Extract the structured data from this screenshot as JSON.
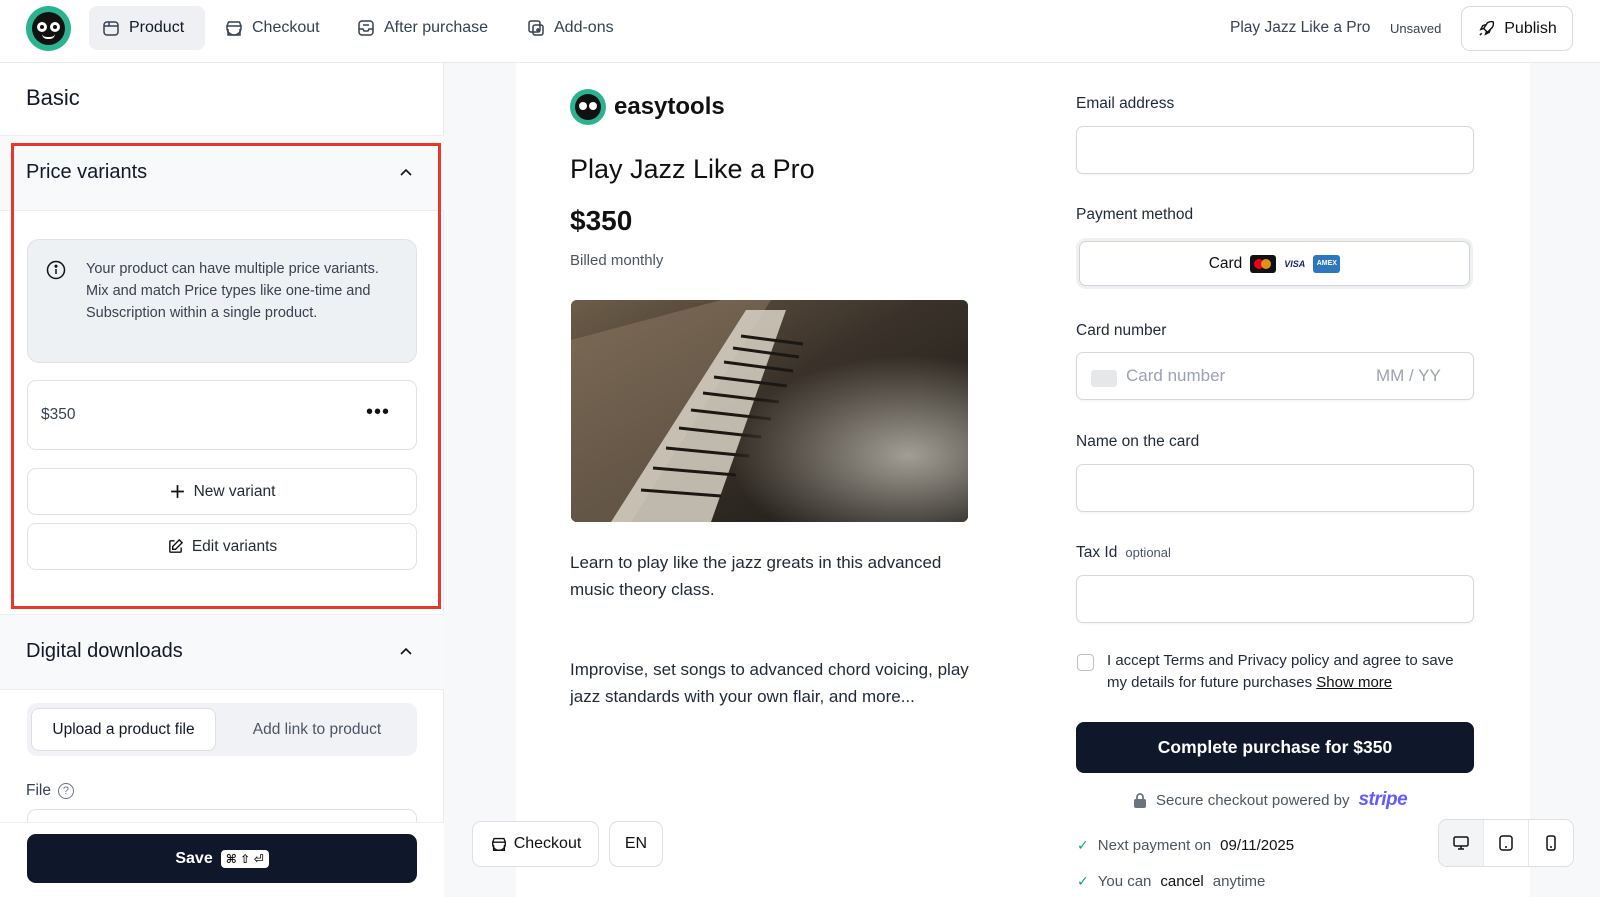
{
  "topbar": {
    "nav": [
      "Product",
      "Checkout",
      "After purchase",
      "Add-ons"
    ],
    "doc_title": "Play Jazz Like a Pro",
    "status": "Unsaved",
    "publish_label": "Publish"
  },
  "sidebar": {
    "basic_heading": "Basic",
    "price_variants": {
      "heading": "Price variants",
      "info": "Your product can have multiple price variants. Mix and match Price types like one-time and Subscription within a single product.",
      "variants": [
        "$350"
      ],
      "new_variant_label": "New variant",
      "edit_variants_label": "Edit variants"
    },
    "digital_downloads": {
      "heading": "Digital downloads",
      "tabs": [
        "Upload a product file",
        "Add link to product"
      ],
      "file_label": "File",
      "help_glyph": "?"
    },
    "save_label": "Save",
    "save_shortcut": "⌘ ⇧ ⏎"
  },
  "preview": {
    "brand": "easytools",
    "title": "Play Jazz Like a Pro",
    "price": "$350",
    "billing": "Billed monthly",
    "description_1": "Learn to play like the jazz greats in this advanced music theory class.",
    "description_2": "Improvise, set songs to advanced chord voicing, play jazz standards with your own flair, and more...",
    "checkout_pill": "Checkout",
    "lang_pill": "EN"
  },
  "checkout": {
    "email_label": "Email address",
    "payment_label": "Payment method",
    "payment_card": "Card",
    "card_brands": [
      "mastercard-icon",
      "visa-icon",
      "amex-icon"
    ],
    "visa_text": "VISA",
    "amex_text": "AMEX",
    "card_number_label": "Card number",
    "card_number_placeholder": "Card number",
    "expiry_placeholder": "MM / YY",
    "name_label": "Name on the card",
    "tax_label": "Tax Id",
    "tax_optional": "optional",
    "terms_text": "I accept Terms and Privacy policy and agree to save my details for future purchases",
    "show_more": "Show more",
    "complete_button": "Complete purchase for $350",
    "secure_text": "Secure checkout powered by",
    "stripe": "stripe",
    "next_payment_prefix": "Next payment on",
    "next_payment_date": "09/11/2025",
    "cancel_prefix": "You can",
    "cancel_word": "cancel",
    "cancel_suffix": "anytime"
  },
  "colors": {
    "highlight": "#e8372b",
    "primary_dark": "#0f172a",
    "brand_green": "#2bb38f",
    "stripe": "#635bff"
  }
}
